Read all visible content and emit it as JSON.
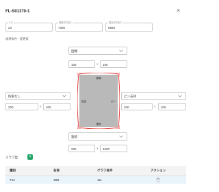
{
  "dialog": {
    "title": "FL-S01370-1"
  },
  "header_fields": [
    {
      "label": "ナビ",
      "value": "23"
    },
    {
      "label": "構造方向長さ",
      "value": "7300"
    },
    {
      "label": "直交方向長さ",
      "value": "6650"
    }
  ],
  "section_label": "境界条件・変更案",
  "top_edge": {
    "select": "固端",
    "dim1": "100",
    "dim2": "150"
  },
  "left_edge": {
    "select": "拘束なし",
    "dim1": "200",
    "dim2": "200"
  },
  "right_edge": {
    "select": "ピン支持",
    "dim1": "200",
    "dim2": "200"
  },
  "bottom_edge": {
    "select": "連続",
    "dim1": "200",
    "dim2": "3400"
  },
  "diagram": {
    "top_mark": "固端",
    "left_mark": "自由",
    "right_mark": "ピン",
    "bottom_mark": "連続",
    "slab_color": "#b9b9b9",
    "border_color": "#e53935"
  },
  "slab_table": {
    "label": "スラブ型",
    "add_icon": "plus-icon",
    "columns": [
      "種別",
      "名称",
      "グラフ長手",
      "アクション"
    ],
    "rows": [
      {
        "kind": "T12",
        "name": "1BB",
        "graph": "111",
        "action_icon": "delete-icon"
      }
    ]
  },
  "colors": {
    "accent_green": "#21a366",
    "row_highlight": "#eaf4fb"
  }
}
